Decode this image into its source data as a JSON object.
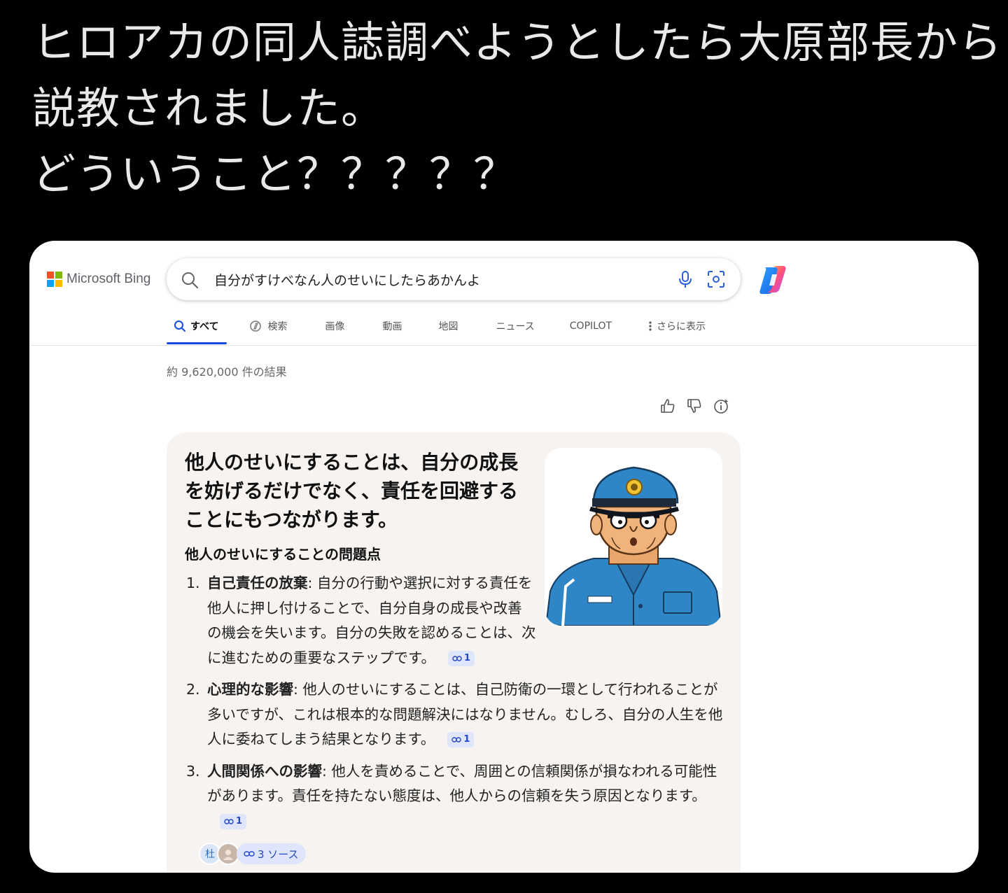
{
  "tweet": {
    "lines": [
      "ヒロアカの同人誌調べようとしたら大原部長から",
      "説教されました。",
      "どういうこと？？？？？"
    ]
  },
  "bing": {
    "logo_text": "Microsoft Bing",
    "search": {
      "query": "自分がすけべなん人のせいにしたらあかんよ"
    },
    "tabs": [
      {
        "label": "すべて",
        "icon": "search-icon",
        "active": true
      },
      {
        "label": "検索",
        "icon": "copilot-search-icon"
      },
      {
        "label": "画像"
      },
      {
        "label": "動画"
      },
      {
        "label": "地図"
      },
      {
        "label": "ニュース"
      },
      {
        "label": "COPILOT"
      },
      {
        "label": "さらに表示",
        "icon": "more-vertical-icon"
      }
    ],
    "result_count": "約 9,620,000 件の結果",
    "answer": {
      "title": "他人のせいにすることは、自分の成長を妨げるだけでなく、責任を回避することにもつながります。",
      "subtitle": "他人のせいにすることの問題点",
      "items": [
        {
          "num": "1.",
          "term": "自己責任の放棄",
          "text": ": 自分の行動や選択に対する責任を他人に押し付けることで、自分自身の成長や改善の機会を失います。自分の失敗を認めることは、次に進むための重要なステップです。",
          "cite": "1"
        },
        {
          "num": "2.",
          "term": "心理的な影響",
          "text": ": 他人のせいにすることは、自己防衛の一環として行われることが多いですが、これは根本的な問題解決にはなりません。むしろ、自分の人生を他人に委ねてしまう結果となります。",
          "cite": "1"
        },
        {
          "num": "3.",
          "term": "人間関係への影響",
          "text": ": 他人を責めることで、周囲との信頼関係が損なわれる可能性があります。責任を持たない態度は、他人からの信頼を失う原因となります。",
          "cite": "1"
        }
      ],
      "sources": {
        "avatar_text": "杜",
        "label": "3 ソース"
      }
    }
  },
  "colors": {
    "ms_red": "#f25022",
    "ms_green": "#7fba00",
    "ms_blue": "#00a4ef",
    "ms_yellow": "#ffb900",
    "tab_accent": "#174ae4",
    "cite_bg": "#dfe6fb",
    "cite_text": "#2647c4",
    "card_bg": "#f6f3f0"
  }
}
